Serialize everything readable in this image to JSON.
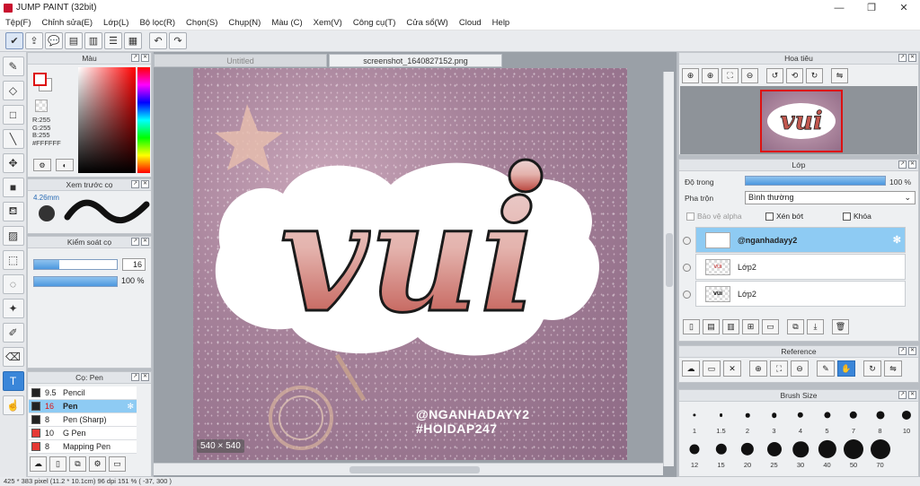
{
  "window": {
    "title": "JUMP PAINT (32bit)",
    "minimize": "—",
    "maximize": "❐",
    "close": "✕"
  },
  "menu": [
    "Tệp(F)",
    "Chỉnh sửa(E)",
    "Lớp(L)",
    "Bộ lọc(R)",
    "Chọn(S)",
    "Chụp(N)",
    "Màu (C)",
    "Xem(V)",
    "Công cụ(T)",
    "Cửa sổ(W)",
    "Cloud",
    "Help"
  ],
  "toolbar_icons": [
    "check-icon",
    "share-icon",
    "comment-icon",
    "message-icon",
    "document-icon",
    "list-icon",
    "grid-icon",
    "undo-icon",
    "redo-icon"
  ],
  "tools": [
    "brush-icon",
    "eraser-icon",
    "rectangle-icon",
    "line-icon",
    "move-icon",
    "fill-icon",
    "bucket-icon",
    "gradient-icon",
    "select-rect-icon",
    "lasso-icon",
    "magic-wand-icon",
    "select-pen-icon",
    "select-eraser-icon",
    "text-icon",
    "hand-icon"
  ],
  "color_panel": {
    "title": "Màu",
    "r": "R:255",
    "g": "G:255",
    "b": "B:255",
    "hex": "#FFFFFF"
  },
  "brush_preview": {
    "title": "Xem trước cọ",
    "size": "4.26mm"
  },
  "brush_control": {
    "title": "Kiểm soát cọ",
    "size_value": "16",
    "size_fraction": 0.3,
    "opacity_label": "100 %",
    "opacity_fraction": 1.0
  },
  "brush_list": {
    "title": "Cọ: Pen",
    "items": [
      {
        "size": "9.5",
        "name": "Pencil",
        "color": "#222222"
      },
      {
        "size": "16",
        "name": "Pen",
        "color": "#222222"
      },
      {
        "size": "8",
        "name": "Pen (Sharp)",
        "color": "#222222"
      },
      {
        "size": "10",
        "name": "G Pen",
        "color": "#e53935"
      },
      {
        "size": "8",
        "name": "Mapping Pen",
        "color": "#e53935"
      }
    ]
  },
  "tabs": {
    "inactive": "Untitled",
    "active": "screenshot_1640827152.png"
  },
  "canvas": {
    "artwork_text": "vui",
    "handle1": "@NGANHADAYY2",
    "handle2": "#HOIDAP247",
    "size_badge": "540 × 540"
  },
  "navigator": {
    "title": "Hoa tiêu"
  },
  "layers": {
    "title": "Lớp",
    "opacity_label": "Độ trong",
    "opacity_value": "100 %",
    "blend_label": "Pha trộn",
    "blend_value": "Bình thường",
    "protect_alpha": "Bảo vệ alpha",
    "clipping": "Xén bớt",
    "lock": "Khóa",
    "items": [
      {
        "name": "@nganhadayy2"
      },
      {
        "name": "Lớp2"
      },
      {
        "name": "Lớp2"
      }
    ]
  },
  "reference": {
    "title": "Reference"
  },
  "brush_size": {
    "title": "Brush Size",
    "row1": [
      "1",
      "1.5",
      "2",
      "3",
      "4",
      "5",
      "7",
      "8",
      "10"
    ],
    "row2": [
      "12",
      "15",
      "20",
      "25",
      "30",
      "40",
      "50",
      "70"
    ]
  },
  "status": "425 * 383 pixel   (11.2 * 10.1cm)   96 dpi   151 %   ( -37, 300 )"
}
